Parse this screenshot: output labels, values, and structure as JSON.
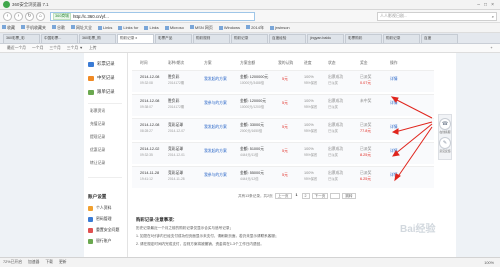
{
  "window": {
    "title": "360安全浏览器 7.1"
  },
  "nav": {
    "back": "‹",
    "forward": "›",
    "refresh": "↻",
    "home": "⌂",
    "site_badge": "360商城",
    "url": "http://c.360.cn/yf...",
    "search_placeholder": "人人影视日剧...",
    "search_icon": "search-icon"
  },
  "bookmarks": [
    "收藏",
    "手机收藏夹",
    "谷歌",
    "网址大全",
    "Links",
    "Links for",
    "Links",
    "Microso",
    "MSN 网页",
    "Windows",
    "2014年",
    "jrwinson"
  ],
  "tabs": [
    "360彩票_彩",
    "中国彩票...",
    "360彩票_购",
    "购彩记录 x",
    "彩票产品",
    "购彩规则",
    "购彩记录",
    "百度经验",
    "jingyan.baidu",
    "彩票购彩",
    "购彩记录",
    "百度"
  ],
  "toolbar": {
    "items": [
      "最近一个月",
      "一个月",
      "三个月",
      "三个月 ▼",
      "上传"
    ],
    "new_tab": "+"
  },
  "sidebar": {
    "items": [
      {
        "label": "彩票记录",
        "color": "#3a7bd5"
      },
      {
        "label": "中奖记录",
        "color": "#f08a24"
      },
      {
        "label": "跟单记录",
        "color": "#6aa84f"
      }
    ],
    "sub_items": [
      "彩票资讯",
      "充值记录",
      "提现记录",
      "优惠记录",
      "转让记录"
    ],
    "account_head": "账户设置",
    "account_items": [
      "个人资料",
      "密码管理",
      "重置安全问题",
      "银行账户"
    ]
  },
  "table": {
    "headers": [
      "时间",
      "彩种/期次",
      "方案",
      "方案金额",
      "我的认购",
      "进度",
      "状态",
      "奖金",
      "操作"
    ],
    "rows": [
      {
        "date": "2014-12-08",
        "time": "09:32:08",
        "lottery": "胜负彩",
        "issue": "2014172期",
        "plan": "我发起的方案",
        "amount": "金额: 1200000元",
        "amount_sub": "10000元/3488倍",
        "mine": "5元",
        "progress": "100%",
        "progress_sub": "95%保底",
        "status": "出票成功",
        "status_sub": "已派奖",
        "prize_label": "已派奖",
        "prize": "0.07元",
        "action": "详情"
      },
      {
        "date": "2014-12-08",
        "time": "09:38:07",
        "lottery": "胜负彩",
        "issue": "2014172期",
        "plan": "我参与的方案",
        "amount": "金额: 120000元",
        "amount_sub": "10000元/1200倍",
        "mine": "5元",
        "progress": "100%",
        "progress_sub": "95%保底",
        "status": "出票成功",
        "status_sub": "已派奖",
        "prize_label": "未中奖",
        "prize": "",
        "action": "详情"
      },
      {
        "date": "2014-12-08",
        "time": "08:28:27",
        "lottery": "竞彩足球",
        "issue": "2014-12-07",
        "plan": "我发起的方案",
        "amount": "金额: 33000元",
        "amount_sub": "2000元/1650倍",
        "mine": "5元",
        "progress": "100%",
        "progress_sub": "95%保底",
        "status": "出票成功",
        "status_sub": "已派奖",
        "prize_label": "已派奖",
        "prize": "77.8元",
        "action": "详情"
      },
      {
        "date": "2014-12-02",
        "time": "09:32:35",
        "lottery": "竞彩足球",
        "issue": "2014-12-01",
        "plan": "我发起的方案",
        "amount": "金额: 51000元",
        "amount_sub": "4444元/11倍",
        "mine": "5元",
        "progress": "100%",
        "progress_sub": "95%保底",
        "status": "出票成功",
        "status_sub": "已派奖",
        "prize_label": "已派奖",
        "prize": "8.25元",
        "action": "详情"
      },
      {
        "date": "2014-11-28",
        "time": "19:41:12",
        "lottery": "竞彩足球",
        "issue": "2014-11-28",
        "plan": "我参与的方案",
        "amount": "金额: 55000元",
        "amount_sub": "4444元/12倍",
        "mine": "5元",
        "progress": "100%",
        "progress_sub": "95%保底",
        "status": "出票成功",
        "status_sub": "已派奖",
        "prize_label": "已派奖",
        "prize": "6.25元",
        "action": "详情"
      }
    ]
  },
  "pager": {
    "summary": "共有13条记录，共2页",
    "prev": "上一页",
    "pages": [
      "1",
      "2"
    ],
    "next": "下一页",
    "goto": "跳转"
  },
  "notes": {
    "title": "购彩记录-注意事项：",
    "lines": [
      "历史记录最近一个月之前的购彩记录仅显示合买与追号记录；",
      "1. 如您在5分钟内已经支付成功但页面显示未支付，请刷新页面，若仍未显示请联系客服；",
      "2. 请在规定时间内完成支付，否则方案将被撤销，资金将在1-3个工作日内退回。"
    ]
  },
  "float_panel": {
    "items": [
      "在线客服",
      "意见反馈"
    ]
  },
  "watermark": "Bai经验",
  "status": {
    "left": "72%已开启",
    "items": [
      "加速器",
      "下载",
      "更新"
    ],
    "zoom": "100%"
  }
}
